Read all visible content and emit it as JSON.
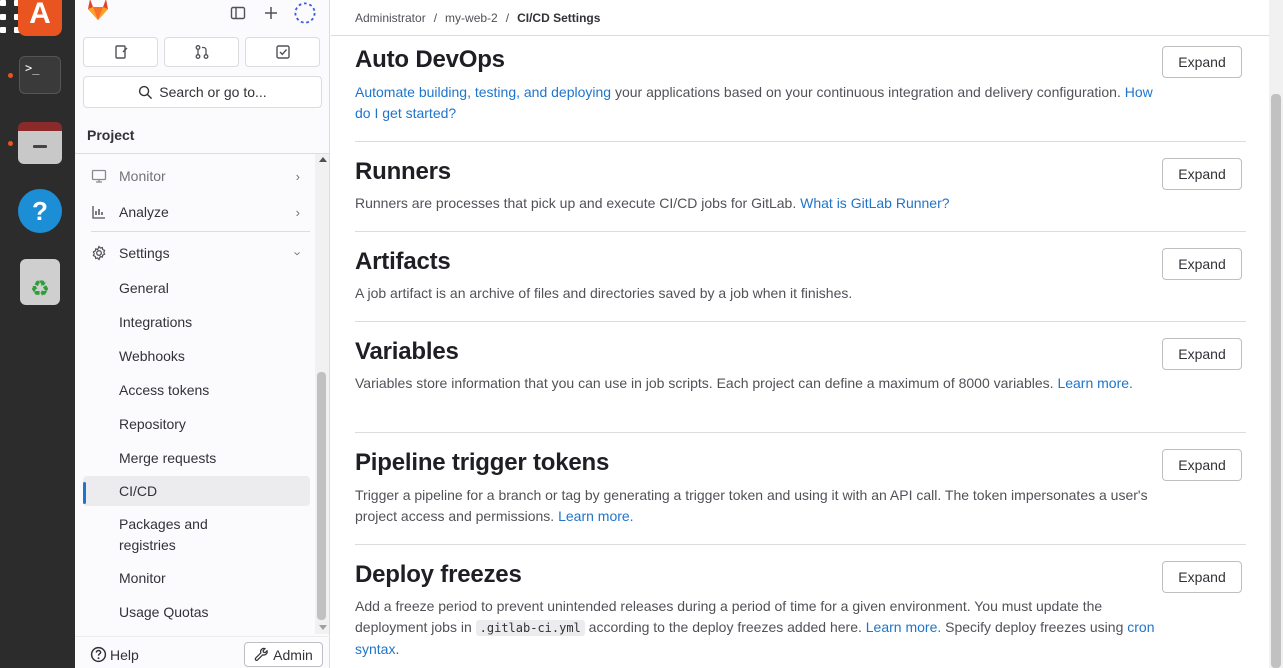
{
  "dock": {
    "apps": [
      "ubuntu-software",
      "terminal",
      "files",
      "help",
      "trash"
    ],
    "terminal_glyph": ">_",
    "help_glyph": "?",
    "trash_glyph": "♻"
  },
  "sidebar": {
    "search_label": "Search or go to...",
    "section_title": "Project",
    "nav": {
      "monitor": "Monitor",
      "analyze": "Analyze",
      "settings": "Settings"
    },
    "settings_items": [
      "General",
      "Integrations",
      "Webhooks",
      "Access tokens",
      "Repository",
      "Merge requests",
      "CI/CD",
      "Packages and registries",
      "Monitor",
      "Usage Quotas"
    ],
    "active_item": "CI/CD",
    "help_label": "Help",
    "admin_label": "Admin"
  },
  "breadcrumb": {
    "items": [
      "Administrator",
      "my-web-2",
      "CI/CD Settings"
    ],
    "separator": "/"
  },
  "sections": {
    "expand_label": "Expand",
    "auto_devops": {
      "title": "Auto DevOps",
      "link1": "Automate building, testing, and deploying",
      "text1": " your applications based on your continuous integration and delivery configuration. ",
      "link2": "How do I get started?"
    },
    "runners": {
      "title": "Runners",
      "text1": "Runners are processes that pick up and execute CI/CD jobs for GitLab. ",
      "link1": "What is GitLab Runner?"
    },
    "artifacts": {
      "title": "Artifacts",
      "text1": "A job artifact is an archive of files and directories saved by a job when it finishes."
    },
    "variables": {
      "title": "Variables",
      "text1": "Variables store information that you can use in job scripts. Each project can define a maximum of 8000 variables. ",
      "link1": "Learn more."
    },
    "pipeline_triggers": {
      "title": "Pipeline trigger tokens",
      "text1": "Trigger a pipeline for a branch or tag by generating a trigger token and using it with an API call. The token impersonates a user's project access and permissions. ",
      "link1": "Learn more."
    },
    "deploy_freezes": {
      "title": "Deploy freezes",
      "text1": "Add a freeze period to prevent unintended releases during a period of time for a given environment. You must update the deployment jobs in ",
      "code": ".gitlab-ci.yml",
      "text2": " according to the deploy freezes added here. ",
      "link1": "Learn more.",
      "text3": " Specify deploy freezes using ",
      "link2": "cron syntax",
      "text4": "."
    }
  },
  "colors": {
    "link": "#1f75cb",
    "accent_orange": "#e95420",
    "active_indicator": "#1f75cb"
  }
}
